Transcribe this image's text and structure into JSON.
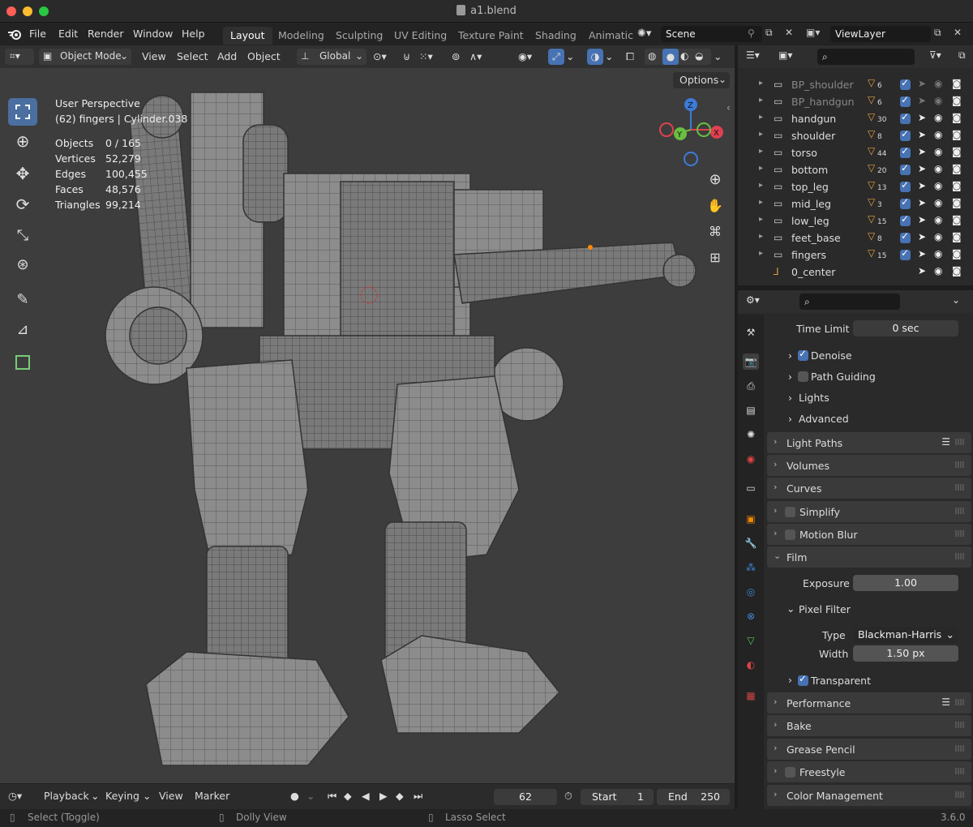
{
  "window": {
    "title": "a1.blend"
  },
  "menubar": {
    "items": [
      "File",
      "Edit",
      "Render",
      "Window",
      "Help"
    ],
    "workspaces": [
      "Layout",
      "Modeling",
      "Sculpting",
      "UV Editing",
      "Texture Paint",
      "Shading",
      "Animatic"
    ],
    "scene": "Scene",
    "view_layer": "ViewLayer"
  },
  "viewport_header": {
    "mode": "Object Mode",
    "menus": [
      "View",
      "Select",
      "Add",
      "Object"
    ],
    "orientation": "Global",
    "options": "Options"
  },
  "overlay": {
    "perspective": "User Perspective",
    "context": "(62) fingers | Cylinder.038",
    "stats": [
      {
        "label": "Objects",
        "value": "0 / 165"
      },
      {
        "label": "Vertices",
        "value": "52,279"
      },
      {
        "label": "Edges",
        "value": "100,455"
      },
      {
        "label": "Faces",
        "value": "48,576"
      },
      {
        "label": "Triangles",
        "value": "99,214"
      }
    ]
  },
  "outliner": {
    "rows": [
      {
        "name": "BP_shoulder",
        "count": "6",
        "dim": true
      },
      {
        "name": "BP_handgun",
        "count": "6",
        "dim": true
      },
      {
        "name": "handgun",
        "count": "30",
        "dim": false
      },
      {
        "name": "shoulder",
        "count": "8",
        "dim": false
      },
      {
        "name": "torso",
        "count": "44",
        "dim": false
      },
      {
        "name": "bottom",
        "count": "20",
        "dim": false
      },
      {
        "name": "top_leg",
        "count": "13",
        "dim": false
      },
      {
        "name": "mid_leg",
        "count": "3",
        "dim": false
      },
      {
        "name": "low_leg",
        "count": "15",
        "dim": false
      },
      {
        "name": "feet_base",
        "count": "8",
        "dim": false
      },
      {
        "name": "fingers",
        "count": "15",
        "dim": false
      },
      {
        "name": "0_center",
        "count": "",
        "dim": false
      }
    ]
  },
  "properties": {
    "time_limit_label": "Time Limit",
    "time_limit_value": "0 sec",
    "denoise": "Denoise",
    "path_guiding": "Path Guiding",
    "lights": "Lights",
    "advanced": "Advanced",
    "panels": [
      "Light Paths",
      "Volumes",
      "Curves",
      "Simplify",
      "Motion Blur",
      "Film"
    ],
    "exposure_label": "Exposure",
    "exposure_value": "1.00",
    "pixel_filter": "Pixel Filter",
    "type_label": "Type",
    "type_value": "Blackman-Harris",
    "width_label": "Width",
    "width_value": "1.50 px",
    "transparent": "Transparent",
    "lower_panels": [
      "Performance",
      "Bake",
      "Grease Pencil",
      "Freestyle",
      "Color Management"
    ]
  },
  "timeline": {
    "playback": "Playback",
    "keying": "Keying",
    "view": "View",
    "marker": "Marker",
    "frame": "62",
    "start_label": "Start",
    "start": "1",
    "end_label": "End",
    "end": "250"
  },
  "statusbar": {
    "select": "Select (Toggle)",
    "dolly": "Dolly View",
    "lasso": "Lasso Select",
    "version": "3.6.0"
  },
  "colors": {
    "accent": "#4772b3",
    "bg": "#3d3d3d",
    "panel": "#2a2a2a"
  }
}
